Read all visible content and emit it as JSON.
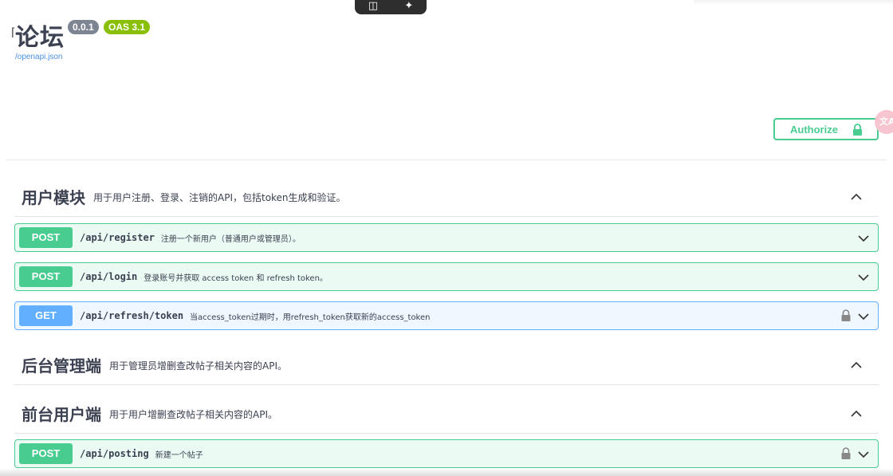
{
  "header": {
    "title": "论坛",
    "version_badge": "0.0.1",
    "oas_badge": "OAS 3.1",
    "spec_link": "/openapi.json"
  },
  "authorize": {
    "label": "Authorize"
  },
  "icons": {
    "lock": "lock-icon",
    "chevron_up": "chevron-up-icon",
    "chevron_down": "chevron-down-icon"
  },
  "colors": {
    "post": "#49cc90",
    "get": "#61affe",
    "version_badge": "#7d8492",
    "oas_badge": "#89bf04",
    "link": "#4990e2"
  },
  "tags": [
    {
      "name": "用户模块",
      "description": "用于用户注册、登录、注销的API，包括token生成和验证。",
      "expanded": true,
      "operations": [
        {
          "method": "POST",
          "path": "/api/register",
          "summary": "注册一个新用户（普通用户或管理员）。",
          "locked": false
        },
        {
          "method": "POST",
          "path": "/api/login",
          "summary": "登录账号并获取 access token 和 refresh token。",
          "locked": false
        },
        {
          "method": "GET",
          "path": "/api/refresh/token",
          "summary": "当access_token过期时，用refresh_token获取新的access_token",
          "locked": true
        }
      ]
    },
    {
      "name": "后台管理端",
      "description": "用于管理员增删查改帖子相关内容的API。",
      "expanded": true,
      "operations": []
    },
    {
      "name": "前台用户端",
      "description": "用于用户增删查改帖子相关内容的API。",
      "expanded": true,
      "operations": [
        {
          "method": "POST",
          "path": "/api/posting",
          "summary": "新建一个帖子",
          "locked": true
        }
      ]
    }
  ]
}
